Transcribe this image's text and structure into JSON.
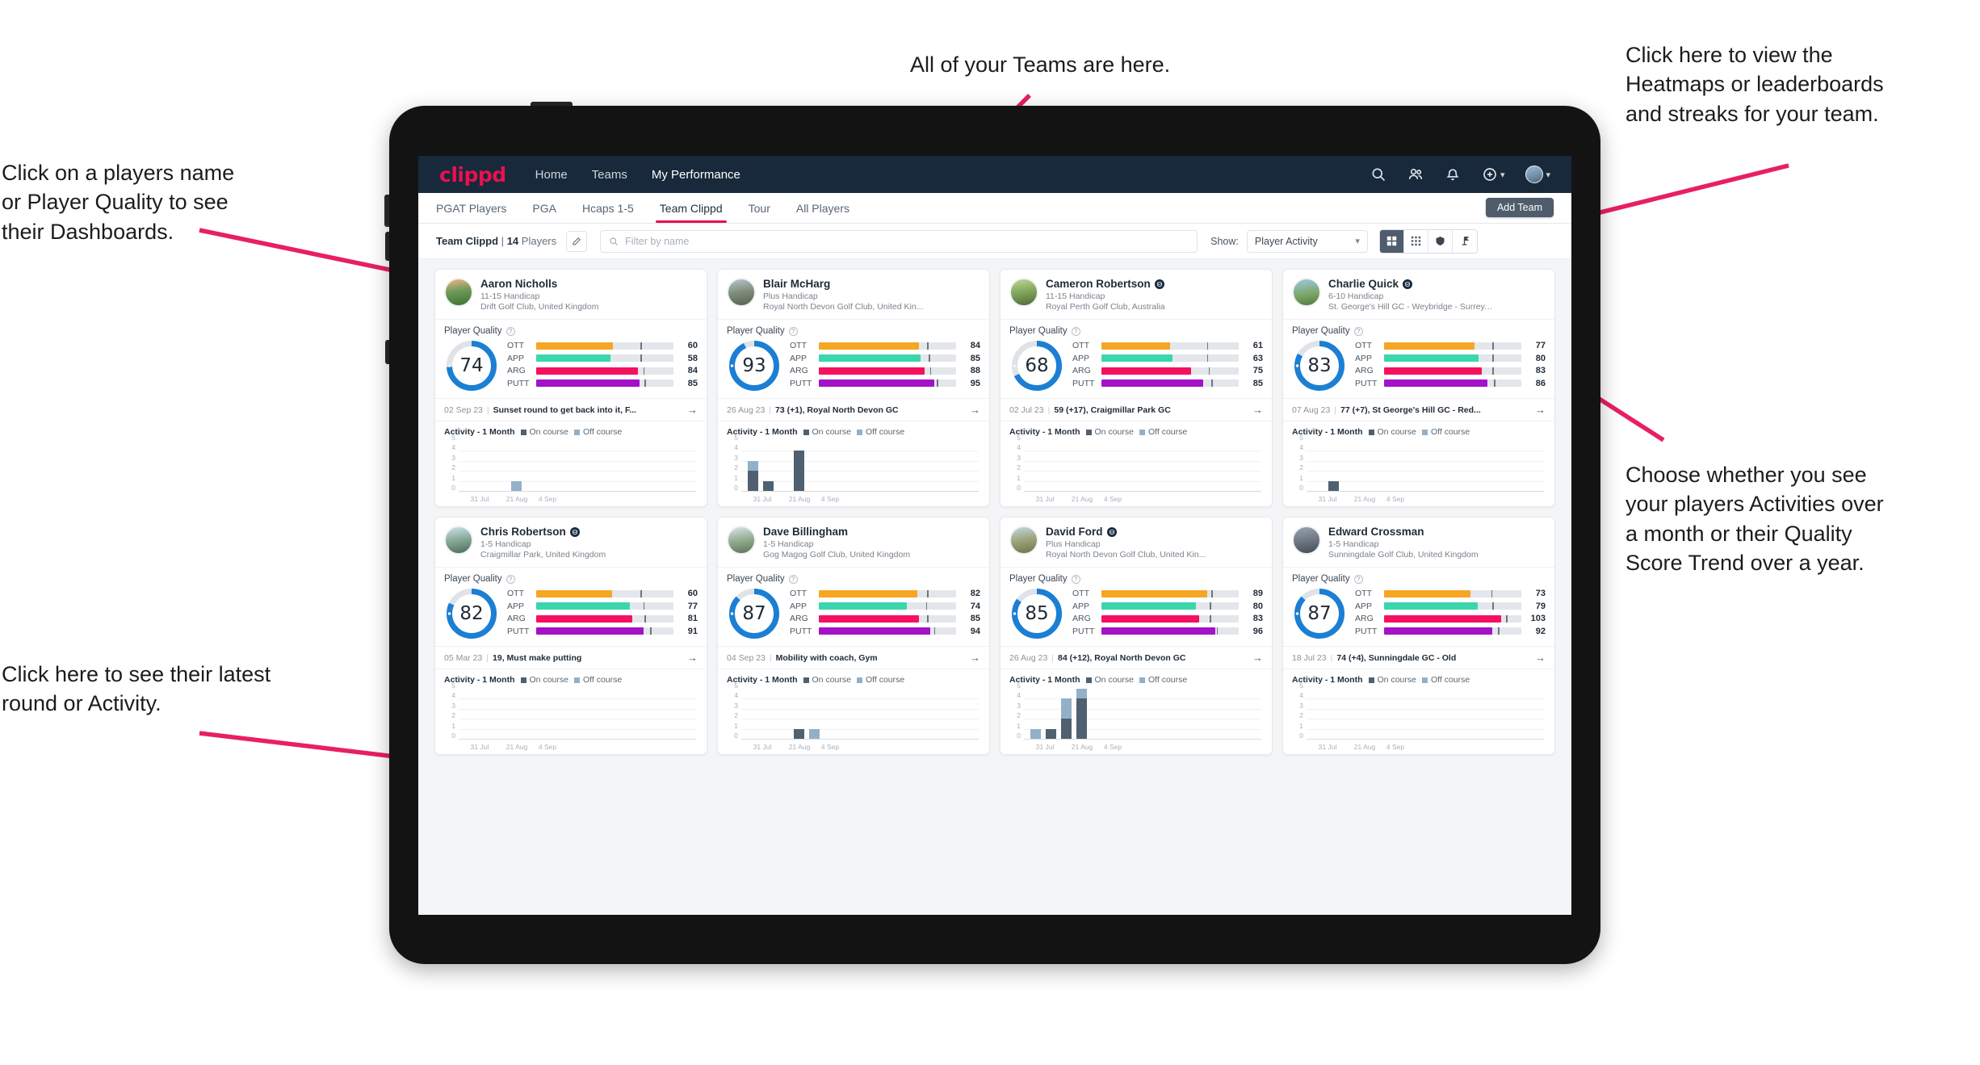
{
  "annotations": [
    {
      "id": "a-teams",
      "text": "All of your Teams are here."
    },
    {
      "id": "a-heatmaps",
      "text": "Click here to view the\nHeatmaps or leaderboards\nand streaks for your team."
    },
    {
      "id": "a-players",
      "text": "Click on a players name\nor Player Quality to see\ntheir Dashboards."
    },
    {
      "id": "a-show",
      "text": "Choose whether you see\nyour players Activities over\na month or their Quality\nScore Trend over a year."
    },
    {
      "id": "a-latest",
      "text": "Click here to see their latest\nround or Activity."
    }
  ],
  "app": {
    "brand": "clippd",
    "nav": [
      {
        "label": "Home",
        "active": false
      },
      {
        "label": "Teams",
        "active": false
      },
      {
        "label": "My Performance",
        "active": true
      }
    ],
    "nav_icons": [
      "search-icon",
      "people-icon",
      "bell-icon",
      "plus-circle-icon",
      "avatar"
    ],
    "tabs": [
      {
        "label": "PGAT Players",
        "active": false
      },
      {
        "label": "PGA",
        "active": false
      },
      {
        "label": "Hcaps 1-5",
        "active": false
      },
      {
        "label": "Team Clippd",
        "active": true
      },
      {
        "label": "Tour",
        "active": false
      },
      {
        "label": "All Players",
        "active": false
      }
    ],
    "add_team_label": "Add Team",
    "filter": {
      "team_name": "Team Clippd",
      "divider": "|",
      "player_count": "14",
      "players_word": "Players",
      "edit_icon": "pencil-icon",
      "search_placeholder": "Filter by name",
      "search_value": "",
      "show_label": "Show:",
      "show_value": "Player Activity",
      "show_options": [
        "Player Activity",
        "Quality Score Trend"
      ],
      "view_buttons": [
        {
          "icon": "grid-large-icon",
          "selected": true
        },
        {
          "icon": "grid-small-icon",
          "selected": false
        },
        {
          "icon": "shield-icon",
          "selected": false
        },
        {
          "icon": "golf-flag-icon",
          "selected": false
        }
      ]
    }
  },
  "card_labels": {
    "player_quality": "Player Quality",
    "activity_title": "Activity - 1 Month",
    "legend_on": "On course",
    "legend_off": "Off course",
    "arrow": "→"
  },
  "colors": {
    "brand": "#e8114e",
    "navbar": "#17293a",
    "ring": "#1b7fd4",
    "ott": "#f5a623",
    "app": "#3ad6ae",
    "arg": "#f5115f",
    "putt": "#a312c8",
    "on_course": "#4f6070",
    "off_course": "#93b0c8"
  },
  "metric_keys": [
    "OTT",
    "APP",
    "ARG",
    "PUTT"
  ],
  "chart_axis": {
    "yticks": [
      5,
      4,
      3,
      2,
      1,
      0
    ],
    "ymax": 5,
    "xticks": [
      "31 Jul",
      "21 Aug",
      "4 Sep"
    ]
  },
  "players": [
    {
      "name": "Aaron Nicholls",
      "verified": false,
      "handicap": "11-15 Handicap",
      "club": "Drift Golf Club, United Kingdom",
      "quality": 74,
      "metrics": [
        {
          "key": "OTT",
          "value": 60,
          "fill": 56,
          "tick": 76
        },
        {
          "key": "APP",
          "value": 58,
          "fill": 54,
          "tick": 76
        },
        {
          "key": "ARG",
          "value": 84,
          "fill": 74,
          "tick": 78
        },
        {
          "key": "PUTT",
          "value": 85,
          "fill": 75,
          "tick": 79
        }
      ],
      "latest_date": "02 Sep 23",
      "latest_text": "Sunset round to get back into it, F...",
      "chart_data": {
        "type": "bar",
        "title": "Activity - 1 Month",
        "categories": [
          "31 Jul",
          "21 Aug",
          "4 Sep"
        ],
        "ylim": [
          0,
          5
        ],
        "series": [
          {
            "name": "On course",
            "values": [
              0,
              0,
              0,
              0,
              0
            ]
          },
          {
            "name": "Off course",
            "values": [
              0,
              0,
              0,
              1,
              0
            ]
          }
        ]
      }
    },
    {
      "name": "Blair McHarg",
      "verified": false,
      "handicap": "Plus Handicap",
      "club": "Royal North Devon Golf Club, United Kin...",
      "quality": 93,
      "metrics": [
        {
          "key": "OTT",
          "value": 84,
          "fill": 73,
          "tick": 79
        },
        {
          "key": "APP",
          "value": 85,
          "fill": 74,
          "tick": 80
        },
        {
          "key": "ARG",
          "value": 88,
          "fill": 77,
          "tick": 81
        },
        {
          "key": "PUTT",
          "value": 95,
          "fill": 84,
          "tick": 86
        }
      ],
      "latest_date": "26 Aug 23",
      "latest_text": "73 (+1), Royal North Devon GC",
      "chart_data": {
        "type": "bar",
        "title": "Activity - 1 Month",
        "categories": [
          "31 Jul",
          "21 Aug",
          "4 Sep"
        ],
        "ylim": [
          0,
          5
        ],
        "series": [
          {
            "name": "On course",
            "values": [
              2,
              1,
              0,
              4,
              0
            ]
          },
          {
            "name": "Off course",
            "values": [
              1,
              0,
              0,
              0,
              0
            ]
          }
        ]
      }
    },
    {
      "name": "Cameron Robertson",
      "verified": true,
      "handicap": "11-15 Handicap",
      "club": "Royal Perth Golf Club, Australia",
      "quality": 68,
      "metrics": [
        {
          "key": "OTT",
          "value": 61,
          "fill": 50,
          "tick": 77
        },
        {
          "key": "APP",
          "value": 63,
          "fill": 52,
          "tick": 77
        },
        {
          "key": "ARG",
          "value": 75,
          "fill": 65,
          "tick": 78
        },
        {
          "key": "PUTT",
          "value": 85,
          "fill": 74,
          "tick": 80
        }
      ],
      "latest_date": "02 Jul 23",
      "latest_text": "59 (+17), Craigmillar Park GC",
      "chart_data": {
        "type": "bar",
        "title": "Activity - 1 Month",
        "categories": [
          "31 Jul",
          "21 Aug",
          "4 Sep"
        ],
        "ylim": [
          0,
          5
        ],
        "series": [
          {
            "name": "On course",
            "values": [
              0,
              0,
              0,
              0,
              0
            ]
          },
          {
            "name": "Off course",
            "values": [
              0,
              0,
              0,
              0,
              0
            ]
          }
        ]
      }
    },
    {
      "name": "Charlie Quick",
      "verified": true,
      "handicap": "6-10 Handicap",
      "club": "St. George's Hill GC - Weybridge - Surrey, ...",
      "quality": 83,
      "metrics": [
        {
          "key": "OTT",
          "value": 77,
          "fill": 66,
          "tick": 79
        },
        {
          "key": "APP",
          "value": 80,
          "fill": 69,
          "tick": 79
        },
        {
          "key": "ARG",
          "value": 83,
          "fill": 71,
          "tick": 79
        },
        {
          "key": "PUTT",
          "value": 86,
          "fill": 75,
          "tick": 80
        }
      ],
      "latest_date": "07 Aug 23",
      "latest_text": "77 (+7), St George's Hill GC - Red...",
      "chart_data": {
        "type": "bar",
        "title": "Activity - 1 Month",
        "categories": [
          "31 Jul",
          "21 Aug",
          "4 Sep"
        ],
        "ylim": [
          0,
          5
        ],
        "series": [
          {
            "name": "On course",
            "values": [
              0,
              1,
              0,
              0,
              0
            ]
          },
          {
            "name": "Off course",
            "values": [
              0,
              0,
              0,
              0,
              0
            ]
          }
        ]
      }
    },
    {
      "name": "Chris Robertson",
      "verified": true,
      "handicap": "1-5 Handicap",
      "club": "Craigmillar Park, United Kingdom",
      "quality": 82,
      "metrics": [
        {
          "key": "OTT",
          "value": 60,
          "fill": 55,
          "tick": 76
        },
        {
          "key": "APP",
          "value": 77,
          "fill": 68,
          "tick": 78
        },
        {
          "key": "ARG",
          "value": 81,
          "fill": 70,
          "tick": 79
        },
        {
          "key": "PUTT",
          "value": 91,
          "fill": 78,
          "tick": 83
        }
      ],
      "latest_date": "05 Mar 23",
      "latest_text": "19, Must make putting",
      "chart_data": {
        "type": "bar",
        "title": "Activity - 1 Month",
        "categories": [
          "31 Jul",
          "21 Aug",
          "4 Sep"
        ],
        "ylim": [
          0,
          5
        ],
        "series": [
          {
            "name": "On course",
            "values": [
              0,
              0,
              0,
              0,
              0
            ]
          },
          {
            "name": "Off course",
            "values": [
              0,
              0,
              0,
              0,
              0
            ]
          }
        ]
      }
    },
    {
      "name": "Dave Billingham",
      "verified": false,
      "handicap": "1-5 Handicap",
      "club": "Gog Magog Golf Club, United Kingdom",
      "quality": 87,
      "metrics": [
        {
          "key": "OTT",
          "value": 82,
          "fill": 72,
          "tick": 79
        },
        {
          "key": "APP",
          "value": 74,
          "fill": 64,
          "tick": 78
        },
        {
          "key": "ARG",
          "value": 85,
          "fill": 73,
          "tick": 79
        },
        {
          "key": "PUTT",
          "value": 94,
          "fill": 81,
          "tick": 84
        }
      ],
      "latest_date": "04 Sep 23",
      "latest_text": "Mobility with coach, Gym",
      "chart_data": {
        "type": "bar",
        "title": "Activity - 1 Month",
        "categories": [
          "31 Jul",
          "21 Aug",
          "4 Sep"
        ],
        "ylim": [
          0,
          5
        ],
        "series": [
          {
            "name": "On course",
            "values": [
              0,
              0,
              0,
              1,
              0
            ]
          },
          {
            "name": "Off course",
            "values": [
              0,
              0,
              0,
              0,
              1
            ]
          }
        ]
      }
    },
    {
      "name": "David Ford",
      "verified": true,
      "handicap": "Plus Handicap",
      "club": "Royal North Devon Golf Club, United Kin...",
      "quality": 85,
      "metrics": [
        {
          "key": "OTT",
          "value": 89,
          "fill": 77,
          "tick": 80
        },
        {
          "key": "APP",
          "value": 80,
          "fill": 69,
          "tick": 79
        },
        {
          "key": "ARG",
          "value": 83,
          "fill": 71,
          "tick": 79
        },
        {
          "key": "PUTT",
          "value": 96,
          "fill": 83,
          "tick": 84
        }
      ],
      "latest_date": "26 Aug 23",
      "latest_text": "84 (+12), Royal North Devon GC",
      "chart_data": {
        "type": "bar",
        "title": "Activity - 1 Month",
        "categories": [
          "31 Jul",
          "21 Aug",
          "4 Sep"
        ],
        "ylim": [
          0,
          5
        ],
        "series": [
          {
            "name": "On course",
            "values": [
              0,
              1,
              2,
              4,
              0
            ]
          },
          {
            "name": "Off course",
            "values": [
              1,
              0,
              2,
              1,
              0
            ]
          }
        ]
      }
    },
    {
      "name": "Edward Crossman",
      "verified": false,
      "handicap": "1-5 Handicap",
      "club": "Sunningdale Golf Club, United Kingdom",
      "quality": 87,
      "metrics": [
        {
          "key": "OTT",
          "value": 73,
          "fill": 63,
          "tick": 78
        },
        {
          "key": "APP",
          "value": 79,
          "fill": 68,
          "tick": 79
        },
        {
          "key": "ARG",
          "value": 103,
          "fill": 85,
          "tick": 89
        },
        {
          "key": "PUTT",
          "value": 92,
          "fill": 79,
          "tick": 83
        }
      ],
      "latest_date": "18 Jul 23",
      "latest_text": "74 (+4), Sunningdale GC - Old",
      "chart_data": {
        "type": "bar",
        "title": "Activity - 1 Month",
        "categories": [
          "31 Jul",
          "21 Aug",
          "4 Sep"
        ],
        "ylim": [
          0,
          5
        ],
        "series": [
          {
            "name": "On course",
            "values": [
              0,
              0,
              0,
              0,
              0
            ]
          },
          {
            "name": "Off course",
            "values": [
              0,
              0,
              0,
              0,
              0
            ]
          }
        ]
      }
    }
  ]
}
